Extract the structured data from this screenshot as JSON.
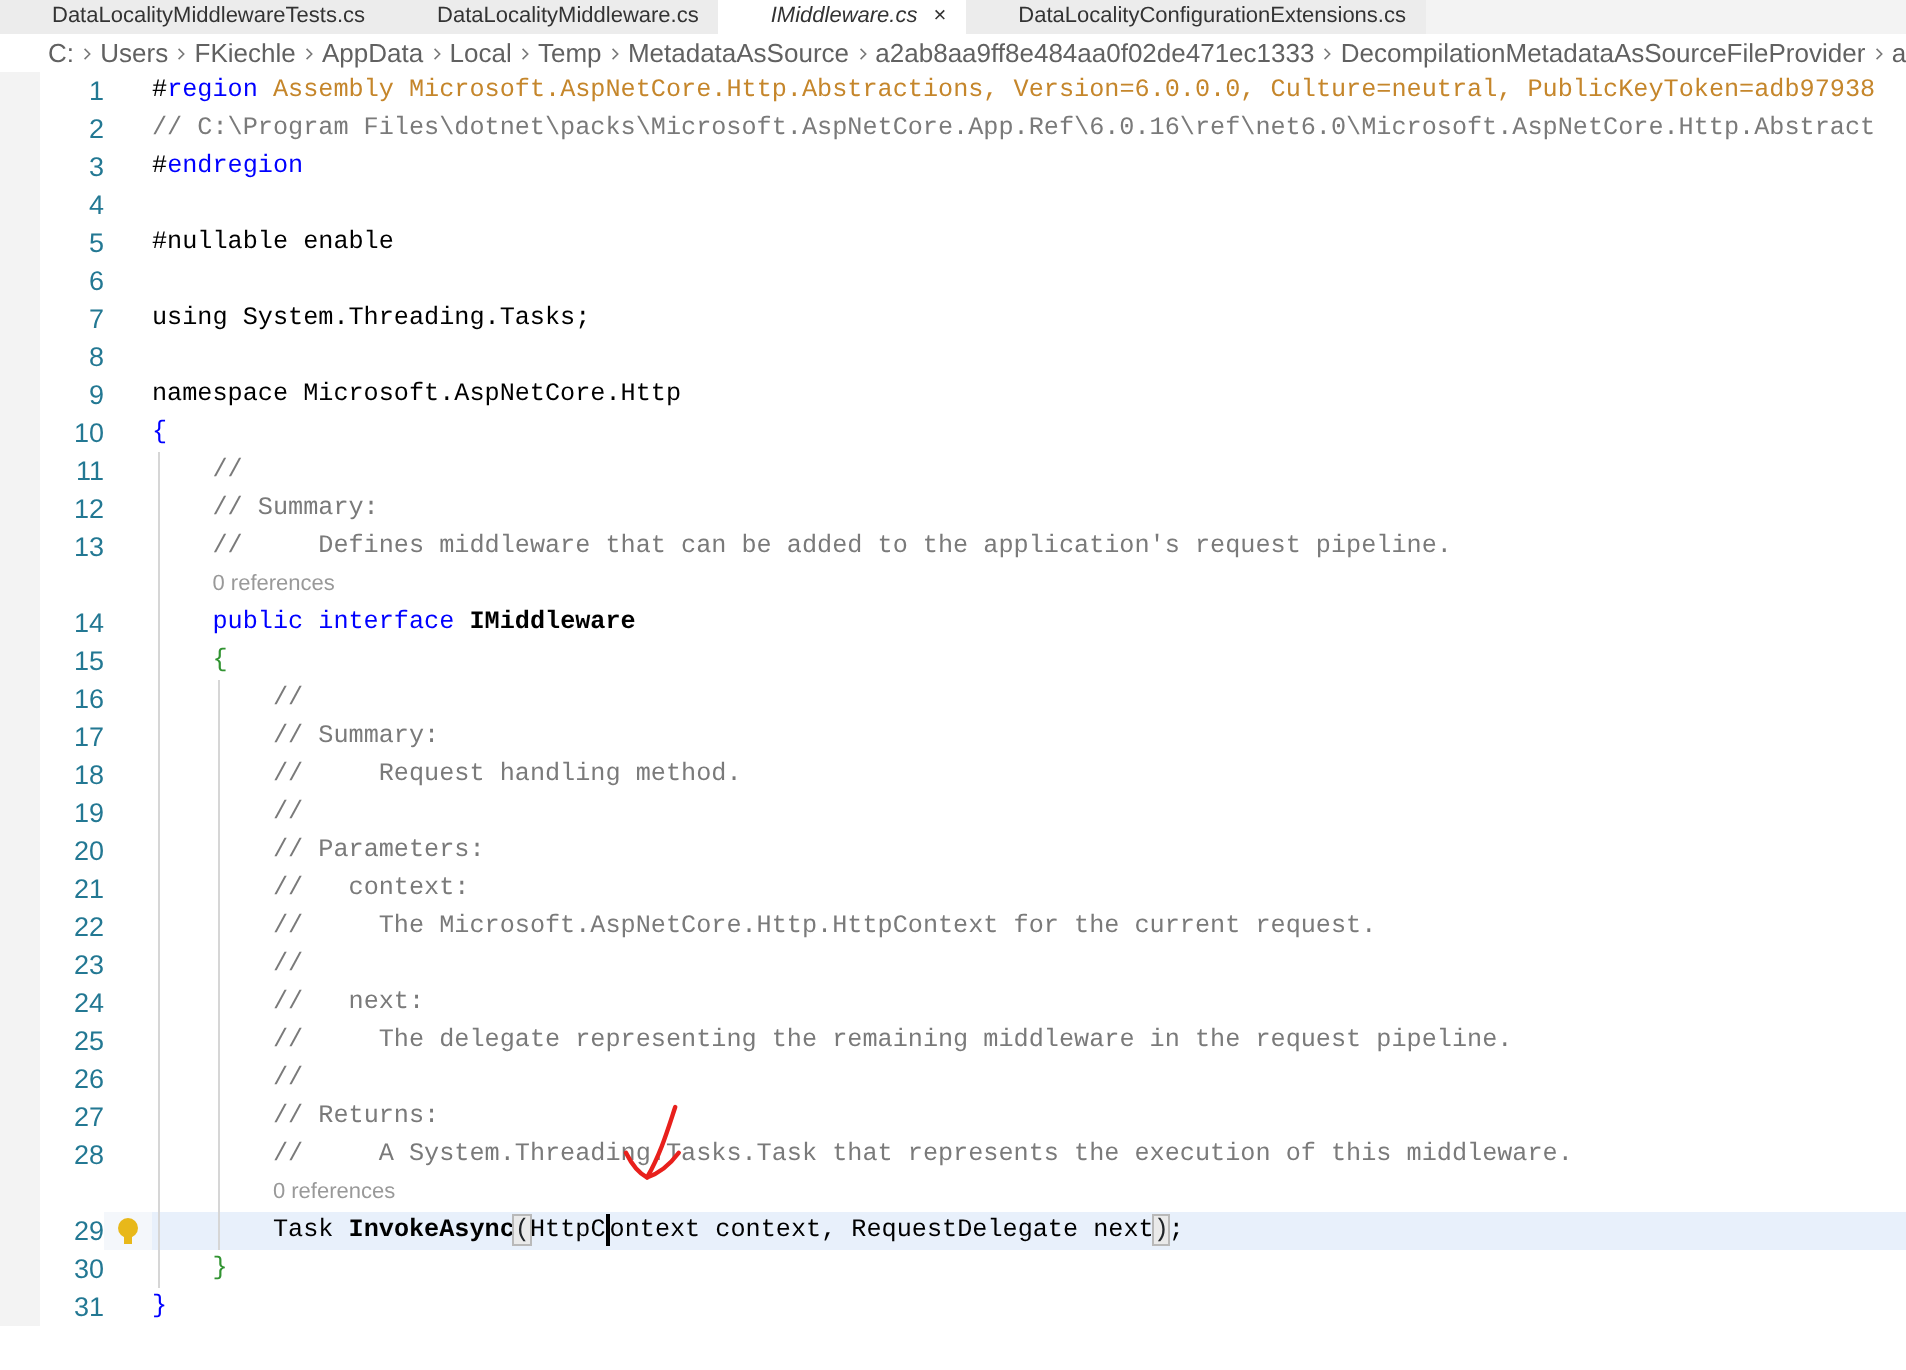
{
  "tabs": [
    {
      "label": "DataLocalityMiddlewareTests.cs",
      "selected": false
    },
    {
      "label": "DataLocalityMiddleware.cs",
      "selected": false
    },
    {
      "label": "IMiddleware.cs",
      "selected": true,
      "close": "×"
    },
    {
      "label": "DataLocalityConfigurationExtensions.cs",
      "selected": false
    }
  ],
  "breadcrumb": [
    "C:",
    "Users",
    "FKiechle",
    "AppData",
    "Local",
    "Temp",
    "MetadataAsSource",
    "a2ab8aa9ff8e484aa0f02de471ec1333",
    "DecompilationMetadataAsSourceFileProvider",
    "a"
  ],
  "lines": [
    {
      "kind": "code",
      "number": "1",
      "current": false,
      "lightbulb": false,
      "tokens": [
        {
          "kind": "plain",
          "text": "#"
        },
        {
          "kind": "keyword",
          "text": "region"
        },
        {
          "kind": "region-text",
          "text": " Assembly Microsoft.AspNetCore.Http.Abstractions, Version=6.0.0.0, Culture=neutral, PublicKeyToken=adb97938"
        }
      ]
    },
    {
      "kind": "code",
      "number": "2",
      "current": false,
      "lightbulb": false,
      "tokens": [
        {
          "kind": "comment",
          "text": "// C:\\Program Files\\dotnet\\packs\\Microsoft.AspNetCore.App.Ref\\6.0.16\\ref\\net6.0\\Microsoft.AspNetCore.Http.Abstract"
        }
      ]
    },
    {
      "kind": "code",
      "number": "3",
      "current": false,
      "lightbulb": false,
      "tokens": [
        {
          "kind": "plain",
          "text": "#"
        },
        {
          "kind": "keyword",
          "text": "endregion"
        }
      ]
    },
    {
      "kind": "code",
      "number": "4",
      "current": false,
      "lightbulb": false
    },
    {
      "kind": "code",
      "number": "5",
      "current": false,
      "lightbulb": false,
      "tokens": [
        {
          "kind": "plain",
          "text": "#nullable enable"
        }
      ]
    },
    {
      "kind": "code",
      "number": "6",
      "current": false,
      "lightbulb": false
    },
    {
      "kind": "code",
      "number": "7",
      "current": false,
      "lightbulb": false,
      "tokens": [
        {
          "kind": "plain",
          "text": "using System.Threading.Tasks;"
        }
      ]
    },
    {
      "kind": "code",
      "number": "8",
      "current": false,
      "lightbulb": false
    },
    {
      "kind": "code",
      "number": "9",
      "current": false,
      "lightbulb": false,
      "tokens": [
        {
          "kind": "plain",
          "text": "namespace Microsoft.AspNetCore.Http"
        }
      ]
    },
    {
      "kind": "code",
      "number": "10",
      "current": false,
      "lightbulb": false,
      "tokens": [
        {
          "kind": "brace-outer",
          "text": "{"
        }
      ]
    },
    {
      "kind": "code",
      "number": "11",
      "current": false,
      "lightbulb": false,
      "tokens": [
        {
          "kind": "comment",
          "text": "    //"
        }
      ]
    },
    {
      "kind": "code",
      "number": "12",
      "current": false,
      "lightbulb": false,
      "tokens": [
        {
          "kind": "comment",
          "text": "    // Summary:"
        }
      ]
    },
    {
      "kind": "code",
      "number": "13",
      "current": false,
      "lightbulb": false,
      "tokens": [
        {
          "kind": "comment",
          "text": "    //     Defines middleware that can be added to the application's request pipeline."
        }
      ]
    },
    {
      "kind": "codelens",
      "text": "    0 references"
    },
    {
      "kind": "code",
      "number": "14",
      "current": false,
      "lightbulb": false,
      "tokens": [
        {
          "kind": "keyword",
          "text": "    public interface "
        },
        {
          "kind": "name",
          "text": "IMiddleware"
        }
      ]
    },
    {
      "kind": "code",
      "number": "15",
      "current": false,
      "lightbulb": false,
      "tokens": [
        {
          "kind": "brace-inner",
          "text": "    {"
        }
      ]
    },
    {
      "kind": "code",
      "number": "16",
      "current": false,
      "lightbulb": false,
      "tokens": [
        {
          "kind": "comment",
          "text": "        //"
        }
      ]
    },
    {
      "kind": "code",
      "number": "17",
      "current": false,
      "lightbulb": false,
      "tokens": [
        {
          "kind": "comment",
          "text": "        // Summary:"
        }
      ]
    },
    {
      "kind": "code",
      "number": "18",
      "current": false,
      "lightbulb": false,
      "tokens": [
        {
          "kind": "comment",
          "text": "        //     Request handling method."
        }
      ]
    },
    {
      "kind": "code",
      "number": "19",
      "current": false,
      "lightbulb": false,
      "tokens": [
        {
          "kind": "comment",
          "text": "        //"
        }
      ]
    },
    {
      "kind": "code",
      "number": "20",
      "current": false,
      "lightbulb": false,
      "tokens": [
        {
          "kind": "comment",
          "text": "        // Parameters:"
        }
      ]
    },
    {
      "kind": "code",
      "number": "21",
      "current": false,
      "lightbulb": false,
      "tokens": [
        {
          "kind": "comment",
          "text": "        //   context:"
        }
      ]
    },
    {
      "kind": "code",
      "number": "22",
      "current": false,
      "lightbulb": false,
      "tokens": [
        {
          "kind": "comment",
          "text": "        //     The Microsoft.AspNetCore.Http.HttpContext for the current request."
        }
      ]
    },
    {
      "kind": "code",
      "number": "23",
      "current": false,
      "lightbulb": false,
      "tokens": [
        {
          "kind": "comment",
          "text": "        //"
        }
      ]
    },
    {
      "kind": "code",
      "number": "24",
      "current": false,
      "lightbulb": false,
      "tokens": [
        {
          "kind": "comment",
          "text": "        //   next:"
        }
      ]
    },
    {
      "kind": "code",
      "number": "25",
      "current": false,
      "lightbulb": false,
      "tokens": [
        {
          "kind": "comment",
          "text": "        //     The delegate representing the remaining middleware in the request pipeline."
        }
      ]
    },
    {
      "kind": "code",
      "number": "26",
      "current": false,
      "lightbulb": false,
      "tokens": [
        {
          "kind": "comment",
          "text": "        //"
        }
      ]
    },
    {
      "kind": "code",
      "number": "27",
      "current": false,
      "lightbulb": false,
      "tokens": [
        {
          "kind": "comment",
          "text": "        // Returns:"
        }
      ]
    },
    {
      "kind": "code",
      "number": "28",
      "current": false,
      "lightbulb": false,
      "tokens": [
        {
          "kind": "comment",
          "text": "        //     A System.Threading.Tasks.Task that represents the execution of this middleware."
        }
      ]
    },
    {
      "kind": "codelens",
      "text": "        0 references"
    },
    {
      "kind": "code",
      "number": "29",
      "current": true,
      "lightbulb": true,
      "tokens": [
        {
          "kind": "plain",
          "text": "        Task "
        },
        {
          "kind": "name",
          "text": "InvokeAsync"
        },
        {
          "kind": "bracket",
          "text": "("
        },
        {
          "kind": "plain",
          "text": "HttpC"
        },
        {
          "kind": "caret"
        },
        {
          "kind": "plain",
          "text": "ontext context, RequestDelegate next"
        },
        {
          "kind": "bracket",
          "text": ")"
        },
        {
          "kind": "plain",
          "text": ";"
        }
      ]
    },
    {
      "kind": "code",
      "number": "30",
      "current": false,
      "lightbulb": false,
      "tokens": [
        {
          "kind": "brace-inner",
          "text": "    }"
        }
      ]
    },
    {
      "kind": "code",
      "number": "31",
      "current": false,
      "lightbulb": false,
      "tokens": [
        {
          "kind": "brace-outer",
          "text": "}"
        }
      ]
    }
  ]
}
